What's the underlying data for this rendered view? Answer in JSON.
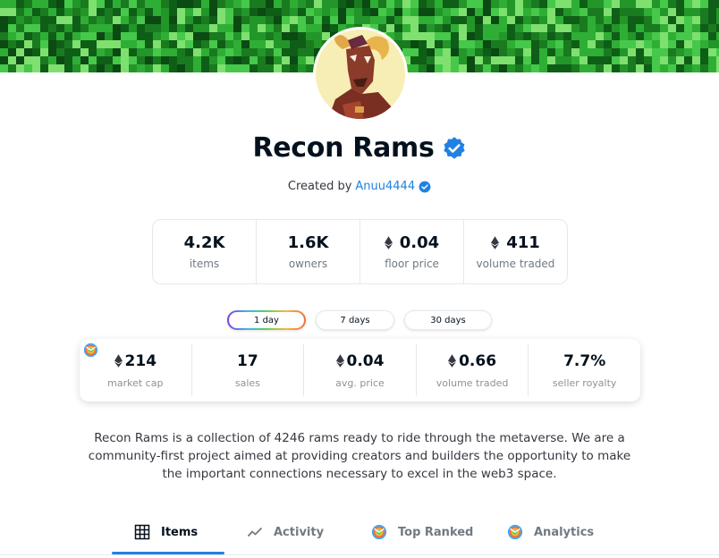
{
  "banner": {
    "name": "collection-banner"
  },
  "collection": {
    "name": "Recon Rams",
    "created_by_label": "Created by",
    "creator": "Anuu4444",
    "description": "Recon Rams is a collection of 4246 rams ready to ride through the metaverse. We are a community-first project aimed at providing creators and builders the opportunity to make the important connections necessary to excel in the web3 space."
  },
  "stats": [
    {
      "value": "4.2K",
      "label": "items",
      "eth": false
    },
    {
      "value": "1.6K",
      "label": "owners",
      "eth": false
    },
    {
      "value": "0.04",
      "label": "floor price",
      "eth": true
    },
    {
      "value": "411",
      "label": "volume traded",
      "eth": true
    }
  ],
  "periods": [
    {
      "label": "1 day",
      "active": true
    },
    {
      "label": "7 days",
      "active": false
    },
    {
      "label": "30 days",
      "active": false
    }
  ],
  "metrics": [
    {
      "value": "214",
      "label": "market cap",
      "eth": true
    },
    {
      "value": "17",
      "label": "sales",
      "eth": false
    },
    {
      "value": "0.04",
      "label": "avg. price",
      "eth": true
    },
    {
      "value": "0.66",
      "label": "volume traded",
      "eth": true
    },
    {
      "value": "7.7%",
      "label": "seller royalty",
      "eth": false
    }
  ],
  "tabs": [
    {
      "label": "Items",
      "icon": "grid-icon",
      "active": true
    },
    {
      "label": "Activity",
      "icon": "activity-chart-icon",
      "active": false
    },
    {
      "label": "Top Ranked",
      "icon": "rainbow-logo-icon",
      "active": false
    },
    {
      "label": "Analytics",
      "icon": "rainbow-logo-icon",
      "active": false
    }
  ],
  "colors": {
    "accent": "#2081e2",
    "text": "#04111d",
    "muted": "#707a83",
    "border": "#e5e8eb",
    "banner_green": "#1f8f23"
  }
}
